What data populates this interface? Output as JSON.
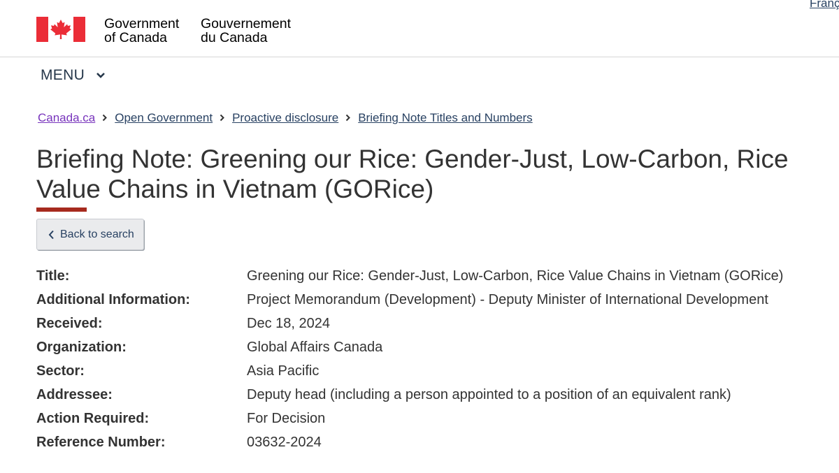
{
  "header": {
    "language_toggle": "Franç",
    "signature_en_line1": "Government",
    "signature_en_line2": "of Canada",
    "signature_fr_line1": "Gouvernement",
    "signature_fr_line2": "du Canada",
    "menu_label": "MENU",
    "flag_color": "#eb2d37"
  },
  "breadcrumb": [
    "Canada.ca",
    "Open Government",
    "Proactive disclosure",
    "Briefing Note Titles and Numbers"
  ],
  "page": {
    "title_line1": "Briefing Note: Greening our Rice: Gender-Just, Low-Carbon, Rice",
    "title_line2": "Value Chains in Vietnam (GORice)",
    "back_label": "Back to search",
    "accent_color": "#a62a1e"
  },
  "details": [
    {
      "label": "Title:",
      "value": "Greening our Rice: Gender-Just, Low-Carbon, Rice Value Chains in Vietnam (GORice)"
    },
    {
      "label": "Additional Information:",
      "value": "Project Memorandum (Development) - Deputy Minister of International Development"
    },
    {
      "label": "Received:",
      "value": "Dec 18, 2024"
    },
    {
      "label": "Organization:",
      "value": "Global Affairs Canada"
    },
    {
      "label": "Sector:",
      "value": "Asia Pacific"
    },
    {
      "label": "Addressee:",
      "value": "Deputy head (including a person appointed to a position of an equivalent rank)"
    },
    {
      "label": "Action Required:",
      "value": "For Decision"
    },
    {
      "label": "Reference Number:",
      "value": "03632-2024"
    }
  ]
}
